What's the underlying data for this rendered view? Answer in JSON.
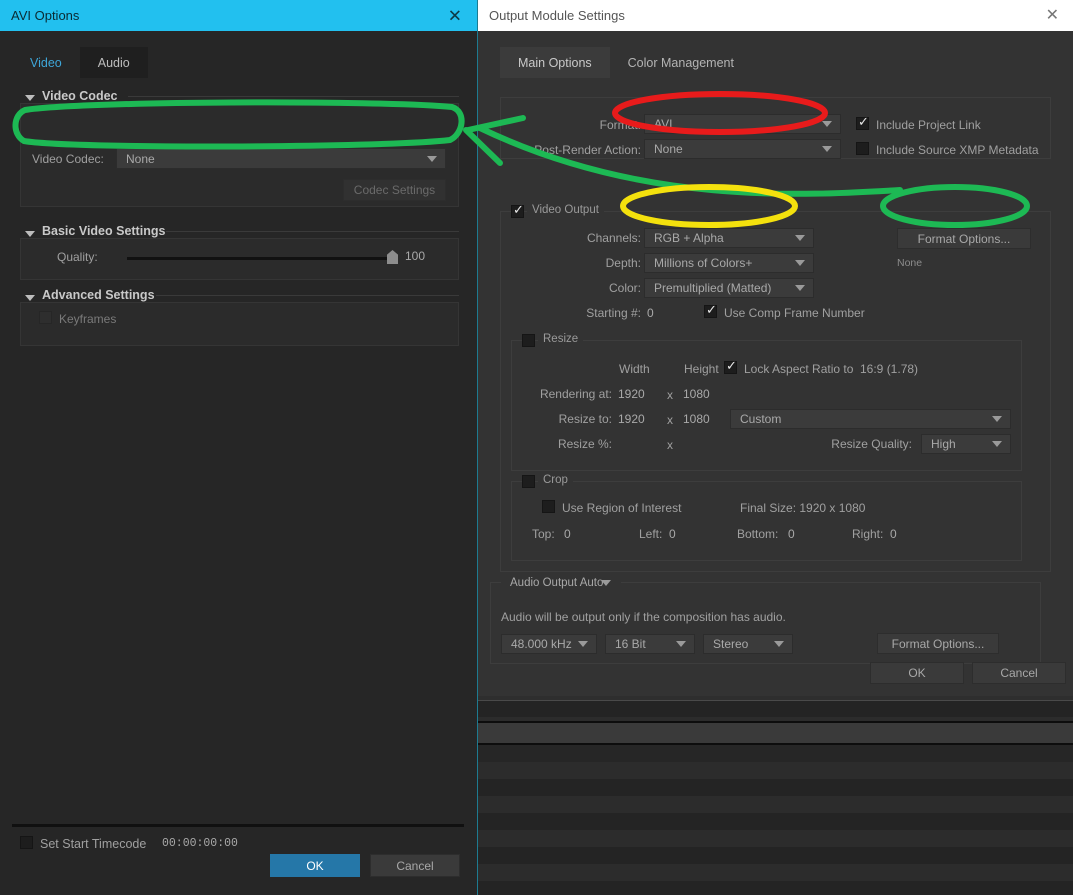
{
  "avi_dialog": {
    "title": "AVI Options",
    "close_icon": "close-icon",
    "tabs": [
      {
        "label": "Video",
        "selected": true
      },
      {
        "label": "Audio",
        "selected": false
      }
    ],
    "sections": {
      "video_codec": {
        "header": "Video Codec",
        "codec_label": "Video Codec:",
        "codec_value": "None",
        "codec_settings_button": "Codec Settings"
      },
      "basic_video_settings": {
        "header": "Basic Video Settings",
        "quality_label": "Quality:",
        "quality_value": "100"
      },
      "advanced_settings": {
        "header": "Advanced Settings",
        "keyframes_label": "Keyframes",
        "keyframes_checked": false
      }
    },
    "footer": {
      "set_start_timecode_label": "Set Start Timecode",
      "set_start_timecode_checked": false,
      "timecode_value": "00:00:00:00",
      "ok_label": "OK",
      "cancel_label": "Cancel"
    }
  },
  "oms_dialog": {
    "title": "Output Module Settings",
    "close_icon": "close-icon",
    "tabs": [
      {
        "label": "Main Options",
        "selected": true
      },
      {
        "label": "Color Management",
        "selected": false
      }
    ],
    "format_group": {
      "format_label": "Format:",
      "format_value": "AVI",
      "post_render_label": "Post-Render Action:",
      "post_render_value": "None",
      "include_project_link_label": "Include Project Link",
      "include_project_link_checked": true,
      "include_xmp_label": "Include Source XMP Metadata",
      "include_xmp_checked": false
    },
    "video_output": {
      "group_label": "Video Output",
      "group_checked": true,
      "channels_label": "Channels:",
      "channels_value": "RGB + Alpha",
      "depth_label": "Depth:",
      "depth_value": "Millions of Colors+",
      "color_label": "Color:",
      "color_value": "Premultiplied (Matted)",
      "starting_label": "Starting #:",
      "starting_value": "0",
      "use_comp_frame_label": "Use Comp Frame Number",
      "use_comp_frame_checked": true,
      "format_options_button": "Format Options...",
      "format_options_status": "None"
    },
    "resize": {
      "group_label": "Resize",
      "group_checked": false,
      "width_header": "Width",
      "height_header": "Height",
      "lock_aspect_label": "Lock Aspect Ratio to",
      "lock_aspect_value": "16:9 (1.78)",
      "lock_aspect_checked": true,
      "rendering_at_label": "Rendering at:",
      "rendering_width": "1920",
      "rendering_x": "x",
      "rendering_height": "1080",
      "resize_to_label": "Resize to:",
      "resize_width": "1920",
      "resize_x": "x",
      "resize_height": "1080",
      "resize_preset": "Custom",
      "resize_pct_label": "Resize %:",
      "resize_pct_x": "x",
      "resize_quality_label": "Resize Quality:",
      "resize_quality_value": "High"
    },
    "crop": {
      "group_label": "Crop",
      "group_checked": false,
      "use_roi_label": "Use Region of Interest",
      "use_roi_checked": false,
      "final_size_label": "Final Size: 1920 x 1080",
      "top_label": "Top:",
      "top_value": "0",
      "left_label": "Left:",
      "left_value": "0",
      "bottom_label": "Bottom:",
      "bottom_value": "0",
      "right_label": "Right:",
      "right_value": "0"
    },
    "audio": {
      "group_label": "Audio Output Auto",
      "note": "Audio will be output only if the composition has audio.",
      "rate_value": "48.000 kHz",
      "depth_value": "16 Bit",
      "channels_value": "Stereo",
      "format_options_button": "Format Options..."
    },
    "footer": {
      "ok_label": "OK",
      "cancel_label": "Cancel"
    }
  },
  "annotations": {
    "red_oval_color": "#e81b1b",
    "yellow_oval_color": "#f4e10d",
    "green_color": "#1db954",
    "targets": [
      "format-dropdown",
      "channels-dropdown",
      "format-options-button",
      "video-codec-dropdown"
    ]
  },
  "theme": {
    "window_bg": "#2b2b2b",
    "dialog_bg": "#333333",
    "panel_bg": "#262626",
    "accent_cyan": "#22c0ef",
    "accent_blue": "#2577a8",
    "text": "#a9a9a9"
  }
}
